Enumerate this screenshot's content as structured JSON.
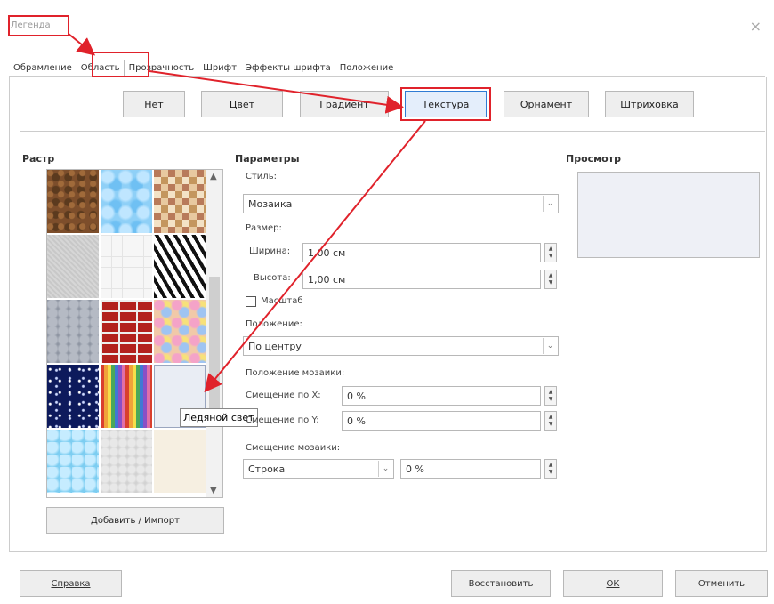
{
  "window": {
    "title": "Легенда",
    "close_glyph": "×"
  },
  "tabs": [
    {
      "label": "Обрамление"
    },
    {
      "label": "Область"
    },
    {
      "label": "Прозрачность"
    },
    {
      "label": "Шрифт"
    },
    {
      "label": "Эффекты шрифта"
    },
    {
      "label": "Положение"
    }
  ],
  "fill_buttons": {
    "none": "Нет",
    "color": "Цвет",
    "gradient": "Градиент",
    "texture": "Текстура",
    "pattern": "Орнамент",
    "hatching": "Штриховка"
  },
  "raster": {
    "heading": "Растр",
    "tooltip": "Ледяной свет",
    "add_button": "Добавить / Импорт"
  },
  "params": {
    "heading": "Параметры",
    "style_label": "Стиль:",
    "style_value": "Мозаика",
    "size_label": "Размер:",
    "width_label": "Ширина:",
    "width_value": "1,00 см",
    "height_label": "Высота:",
    "height_value": "1,00 см",
    "scale_label": "Масштаб",
    "position_label": "Положение:",
    "position_value": "По центру",
    "tile_position_label": "Положение мозаики:",
    "offset_x_label": "Смещение по X:",
    "offset_x_value": "0 %",
    "offset_y_label": "Смещение по Y:",
    "offset_y_value": "0 %",
    "tile_offset_label": "Смещение мозаики:",
    "tile_offset_mode": "Строка",
    "tile_offset_value": "0 %"
  },
  "preview": {
    "heading": "Просмотр"
  },
  "footer": {
    "help": "Справка",
    "reset": "Восстановить",
    "ok": "ОК",
    "cancel": "Отменить"
  },
  "colors": {
    "highlight": "#e0222b",
    "active_border": "#2f7bd4"
  }
}
